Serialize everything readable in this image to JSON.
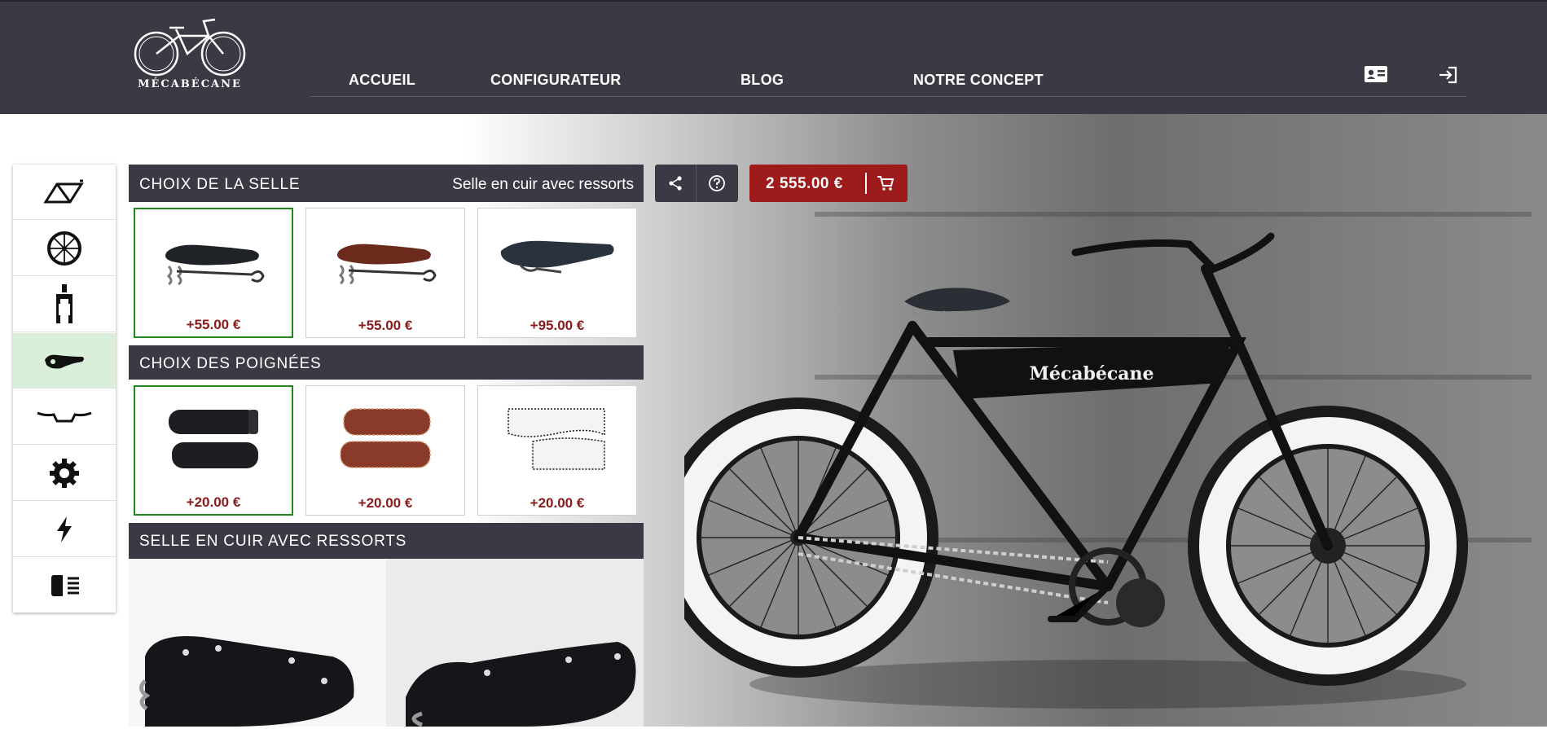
{
  "header": {
    "brand": "MÉCABÉCANE",
    "nav": [
      "ACCUEIL",
      "CONFIGURATEUR",
      "BLOG",
      "NOTRE CONCEPT"
    ],
    "icons": [
      "contact-card-icon",
      "login-icon"
    ]
  },
  "sidebar": {
    "items": [
      {
        "icon": "frame-icon",
        "active": false
      },
      {
        "icon": "wheel-icon",
        "active": false
      },
      {
        "icon": "fork-icon",
        "active": false
      },
      {
        "icon": "saddle-icon",
        "active": true
      },
      {
        "icon": "handlebar-icon",
        "active": false
      },
      {
        "icon": "gear-icon",
        "active": false
      },
      {
        "icon": "lightning-icon",
        "active": false
      },
      {
        "icon": "headlight-icon",
        "active": false
      }
    ]
  },
  "saddle": {
    "title": "CHOIX DE LA SELLE",
    "selected": "Selle en cuir avec ressorts",
    "options": [
      {
        "price": "+55.00 €",
        "color": "#1f2328",
        "selected": true
      },
      {
        "price": "+55.00 €",
        "color": "#6b2a1c",
        "selected": false
      },
      {
        "price": "+95.00 €",
        "color": "#2a333d",
        "selected": false
      }
    ]
  },
  "grips": {
    "title": "CHOIX DES POIGNÉES",
    "options": [
      {
        "price": "+20.00 €",
        "color": "#1e1e22",
        "selected": true
      },
      {
        "price": "+20.00 €",
        "color": "#8a3a2a",
        "selected": false
      },
      {
        "price": "+20.00 €",
        "color": "#f4f4f4",
        "selected": false
      }
    ]
  },
  "detail": {
    "title": "SELLE EN CUIR AVEC RESSORTS"
  },
  "toolbar": {
    "price": "2 555.00 €",
    "icons": [
      "share-icon",
      "help-icon",
      "cart-icon"
    ]
  },
  "bike": {
    "brand_label": "Mécabécane",
    "colors": {
      "frame": "#111111",
      "tire": "#1a1a1a",
      "whitewall": "#f2f4f6",
      "accent": "#9e1b1b"
    }
  }
}
